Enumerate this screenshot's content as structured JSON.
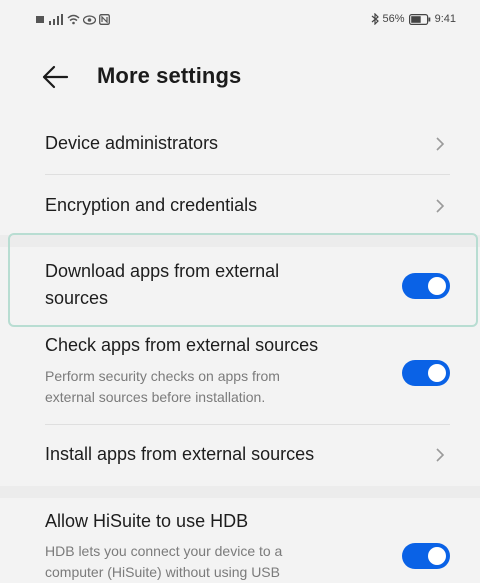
{
  "status": {
    "battery_text": "56%",
    "time": "9:41"
  },
  "header": {
    "title": "More settings"
  },
  "items": [
    {
      "title": "Device administrators"
    },
    {
      "title": "Encryption and credentials"
    },
    {
      "title_line1": "Download apps from external",
      "title_line2": "sources",
      "toggle_on": true
    },
    {
      "title": "Check apps from external sources",
      "sub_line1": "Perform security checks on apps from",
      "sub_line2": "external sources before installation.",
      "toggle_on": true
    },
    {
      "title": "Install apps from external sources"
    },
    {
      "title": "Allow HiSuite to use HDB",
      "sub_line1": "HDB lets you connect your device to a",
      "sub_line2": "computer (HiSuite) without using USB",
      "toggle_on": true
    }
  ],
  "colors": {
    "accent": "#0a62e6",
    "highlight_border": "#b8ddd2"
  }
}
